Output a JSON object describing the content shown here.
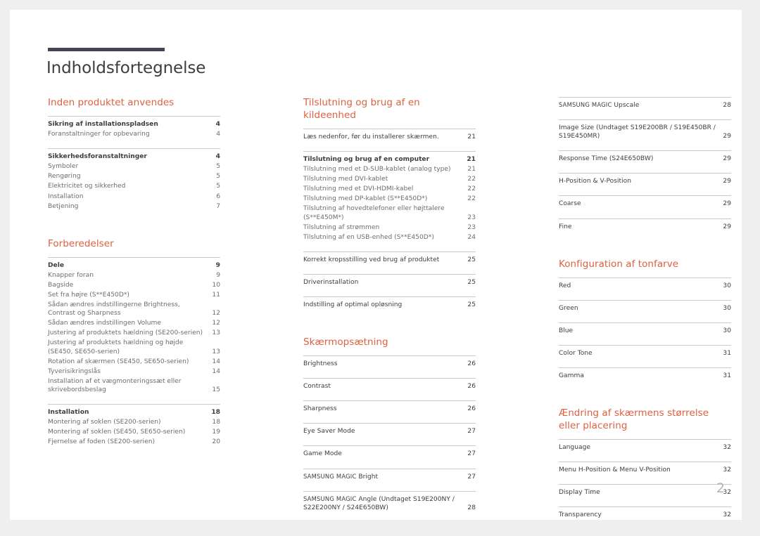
{
  "document": {
    "title": "Indholdsfortegnelse",
    "page_number": "2",
    "accent_color": "#dd6140",
    "rule_color": "#454355"
  },
  "columns": [
    {
      "sections": [
        {
          "title": "Inden produktet anvendes",
          "groups": [
            {
              "rows": [
                {
                  "label": "Sikring af installationspladsen",
                  "page": "4",
                  "style": "main"
                },
                {
                  "label": "Foranstaltninger for opbevaring",
                  "page": "4",
                  "style": "sub"
                }
              ]
            },
            {
              "rows": [
                {
                  "label": "Sikkerhedsforanstaltninger",
                  "page": "4",
                  "style": "main"
                },
                {
                  "label": "Symboler",
                  "page": "5",
                  "style": "sub"
                },
                {
                  "label": "Rengøring",
                  "page": "5",
                  "style": "sub"
                },
                {
                  "label": "Elektricitet og sikkerhed",
                  "page": "5",
                  "style": "sub"
                },
                {
                  "label": "Installation",
                  "page": "6",
                  "style": "sub"
                },
                {
                  "label": "Betjening",
                  "page": "7",
                  "style": "sub"
                }
              ]
            }
          ]
        },
        {
          "title": "Forberedelser",
          "groups": [
            {
              "rows": [
                {
                  "label": "Dele",
                  "page": "9",
                  "style": "main"
                },
                {
                  "label": "Knapper foran",
                  "page": "9",
                  "style": "sub"
                },
                {
                  "label": "Bagside",
                  "page": "10",
                  "style": "sub"
                },
                {
                  "label": "Set fra højre (S**E450D*)",
                  "page": "11",
                  "style": "sub"
                },
                {
                  "label": "Sådan ændres indstillingerne Brightness, Contrast og Sharpness",
                  "page": "12",
                  "style": "sub"
                },
                {
                  "label": "Sådan ændres indstillingen Volume",
                  "page": "12",
                  "style": "sub"
                },
                {
                  "label": "Justering af produktets hældning (SE200-serien)",
                  "page": "13",
                  "style": "sub"
                },
                {
                  "label": "Justering af produktets hældning og højde (SE450, SE650-serien)",
                  "page": "13",
                  "style": "sub"
                },
                {
                  "label": "Rotation af skærmen (SE450, SE650-serien)",
                  "page": "14",
                  "style": "sub"
                },
                {
                  "label": "Tyverisikringslås",
                  "page": "14",
                  "style": "sub"
                },
                {
                  "label": "Installation af et vægmonteringssæt eller skrivebordsbeslag",
                  "page": "15",
                  "style": "sub"
                }
              ]
            },
            {
              "rows": [
                {
                  "label": "Installation",
                  "page": "18",
                  "style": "main"
                },
                {
                  "label": "Montering af soklen (SE200-serien)",
                  "page": "18",
                  "style": "sub"
                },
                {
                  "label": "Montering af soklen (SE450, SE650-serien)",
                  "page": "19",
                  "style": "sub"
                },
                {
                  "label": "Fjernelse af foden (SE200-serien)",
                  "page": "20",
                  "style": "sub"
                }
              ]
            }
          ]
        }
      ]
    },
    {
      "sections": [
        {
          "title": "Tilslutning og brug af en kildeenhed",
          "groups": [
            {
              "rows": [
                {
                  "label": "Læs nedenfor, før du installerer skærmen.",
                  "page": "21",
                  "style": "plain"
                }
              ]
            },
            {
              "rows": [
                {
                  "label": "Tilslutning og brug af en computer",
                  "page": "21",
                  "style": "main"
                },
                {
                  "label": "Tilslutning med et D-SUB-kablet (analog type)",
                  "page": "21",
                  "style": "sub"
                },
                {
                  "label": "Tilslutning med DVI-kablet",
                  "page": "22",
                  "style": "sub"
                },
                {
                  "label": "Tilslutning med et DVI-HDMI-kabel",
                  "page": "22",
                  "style": "sub"
                },
                {
                  "label": "Tilslutning med DP-kablet (S**E450D*)",
                  "page": "22",
                  "style": "sub"
                },
                {
                  "label": "Tilslutning af hovedtelefoner eller højttalere (S**E450M*)",
                  "page": "23",
                  "style": "sub"
                },
                {
                  "label": "Tilslutning af strømmen",
                  "page": "23",
                  "style": "sub"
                },
                {
                  "label": "Tilslutning af en USB-enhed (S**E450D*)",
                  "page": "24",
                  "style": "sub"
                }
              ]
            },
            {
              "rows": [
                {
                  "label": "Korrekt kropsstilling ved brug af produktet",
                  "page": "25",
                  "style": "plain"
                }
              ]
            },
            {
              "rows": [
                {
                  "label": "Driverinstallation",
                  "page": "25",
                  "style": "plain"
                }
              ]
            },
            {
              "rows": [
                {
                  "label": "Indstilling af optimal opløsning",
                  "page": "25",
                  "style": "plain"
                }
              ]
            }
          ]
        },
        {
          "title": "Skærmopsætning",
          "groups": [
            {
              "rows": [
                {
                  "label": "Brightness",
                  "page": "26",
                  "style": "plain"
                }
              ]
            },
            {
              "rows": [
                {
                  "label": "Contrast",
                  "page": "26",
                  "style": "plain"
                }
              ]
            },
            {
              "rows": [
                {
                  "label": "Sharpness",
                  "page": "26",
                  "style": "plain"
                }
              ]
            },
            {
              "rows": [
                {
                  "label": "Eye Saver Mode",
                  "page": "27",
                  "style": "plain"
                }
              ]
            },
            {
              "rows": [
                {
                  "label": "Game Mode",
                  "page": "27",
                  "style": "plain"
                }
              ]
            },
            {
              "rows": [
                {
                  "label": "SAMSUNG MAGIC Bright",
                  "page": "27",
                  "style": "plain"
                }
              ]
            },
            {
              "rows": [
                {
                  "label": "SAMSUNG MAGIC Angle (Undtaget S19E200NY / S22E200NY / S24E650BW)",
                  "page": "28",
                  "style": "plain"
                }
              ]
            }
          ]
        }
      ]
    },
    {
      "sections": [
        {
          "title": "",
          "groups": [
            {
              "rows": [
                {
                  "label": "SAMSUNG MAGIC Upscale",
                  "page": "28",
                  "style": "plain"
                }
              ]
            },
            {
              "rows": [
                {
                  "label": "Image Size (Undtaget S19E200BR / S19E450BR / S19E450MR)",
                  "page": "29",
                  "style": "plain"
                }
              ]
            },
            {
              "rows": [
                {
                  "label": "Response Time (S24E650BW)",
                  "page": "29",
                  "style": "plain"
                }
              ]
            },
            {
              "rows": [
                {
                  "label": "H-Position & V-Position",
                  "page": "29",
                  "style": "plain"
                }
              ]
            },
            {
              "rows": [
                {
                  "label": "Coarse",
                  "page": "29",
                  "style": "plain"
                }
              ]
            },
            {
              "rows": [
                {
                  "label": "Fine",
                  "page": "29",
                  "style": "plain"
                }
              ]
            }
          ]
        },
        {
          "title": "Konfiguration af tonfarve",
          "groups": [
            {
              "rows": [
                {
                  "label": "Red",
                  "page": "30",
                  "style": "plain"
                }
              ]
            },
            {
              "rows": [
                {
                  "label": "Green",
                  "page": "30",
                  "style": "plain"
                }
              ]
            },
            {
              "rows": [
                {
                  "label": "Blue",
                  "page": "30",
                  "style": "plain"
                }
              ]
            },
            {
              "rows": [
                {
                  "label": "Color Tone",
                  "page": "31",
                  "style": "plain"
                }
              ]
            },
            {
              "rows": [
                {
                  "label": "Gamma",
                  "page": "31",
                  "style": "plain"
                }
              ]
            }
          ]
        },
        {
          "title": "Ændring af skærmens størrelse eller placering",
          "groups": [
            {
              "rows": [
                {
                  "label": "Language",
                  "page": "32",
                  "style": "plain"
                }
              ]
            },
            {
              "rows": [
                {
                  "label": "Menu H-Position & Menu V-Position",
                  "page": "32",
                  "style": "plain"
                }
              ]
            },
            {
              "rows": [
                {
                  "label": "Display Time",
                  "page": "32",
                  "style": "plain"
                }
              ]
            },
            {
              "rows": [
                {
                  "label": "Transparency",
                  "page": "32",
                  "style": "plain"
                }
              ]
            }
          ]
        }
      ]
    }
  ]
}
